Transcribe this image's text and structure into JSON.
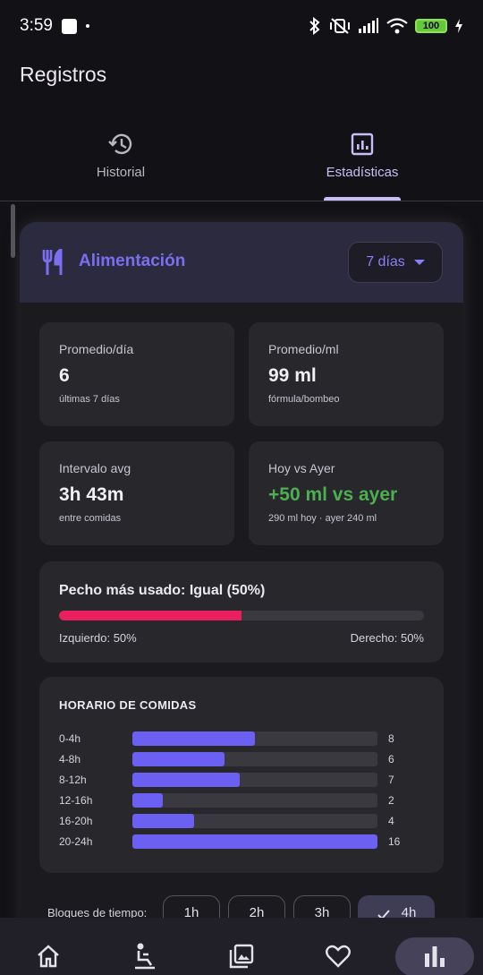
{
  "status_bar": {
    "time": "3:59",
    "battery": "100"
  },
  "appbar": {
    "title": "Registros"
  },
  "tabs": [
    {
      "label": "Historial",
      "icon": "history-icon",
      "active": false
    },
    {
      "label": "Estadísticas",
      "icon": "analytics-icon",
      "active": true
    }
  ],
  "section": {
    "title": "Alimentación",
    "icon": "restaurant-icon",
    "range_selector": "7 días"
  },
  "stats": [
    {
      "label": "Promedio/día",
      "value": "6",
      "sub": "últimas 7 días"
    },
    {
      "label": "Promedio/ml",
      "value": "99 ml",
      "sub": "fórmula/bombeo"
    },
    {
      "label": "Intervalo avg",
      "value": "3h 43m",
      "sub": "entre comidas"
    },
    {
      "label": "Hoy vs Ayer",
      "value": "+50 ml vs ayer",
      "sub": "290 ml hoy · ayer 240 ml",
      "value_color": "#4caf50"
    }
  ],
  "breast": {
    "title": "Pecho más usado: Igual (50%)",
    "left_label": "Izquierdo: 50%",
    "right_label": "Derecho: 50%",
    "left_fraction": 0.5,
    "color": "#ea1f60"
  },
  "schedule": {
    "title": "HORARIO DE COMIDAS",
    "max": 16,
    "color": "#6b60f2",
    "rows": [
      {
        "label": "0-4h",
        "count": 8
      },
      {
        "label": "4-8h",
        "count": 6
      },
      {
        "label": "8-12h",
        "count": 7
      },
      {
        "label": "12-16h",
        "count": 2
      },
      {
        "label": "16-20h",
        "count": 4
      },
      {
        "label": "20-24h",
        "count": 16
      }
    ]
  },
  "time_blocks": {
    "label": "Bloques de tiempo:",
    "options": [
      "1h",
      "2h",
      "3h",
      "4h"
    ],
    "selected": "4h"
  },
  "bottom_nav": [
    {
      "icon": "home-icon"
    },
    {
      "icon": "baby-changing-icon"
    },
    {
      "icon": "photo-library-icon"
    },
    {
      "icon": "heart-icon"
    },
    {
      "icon": "bar-chart-icon",
      "active": true
    }
  ]
}
